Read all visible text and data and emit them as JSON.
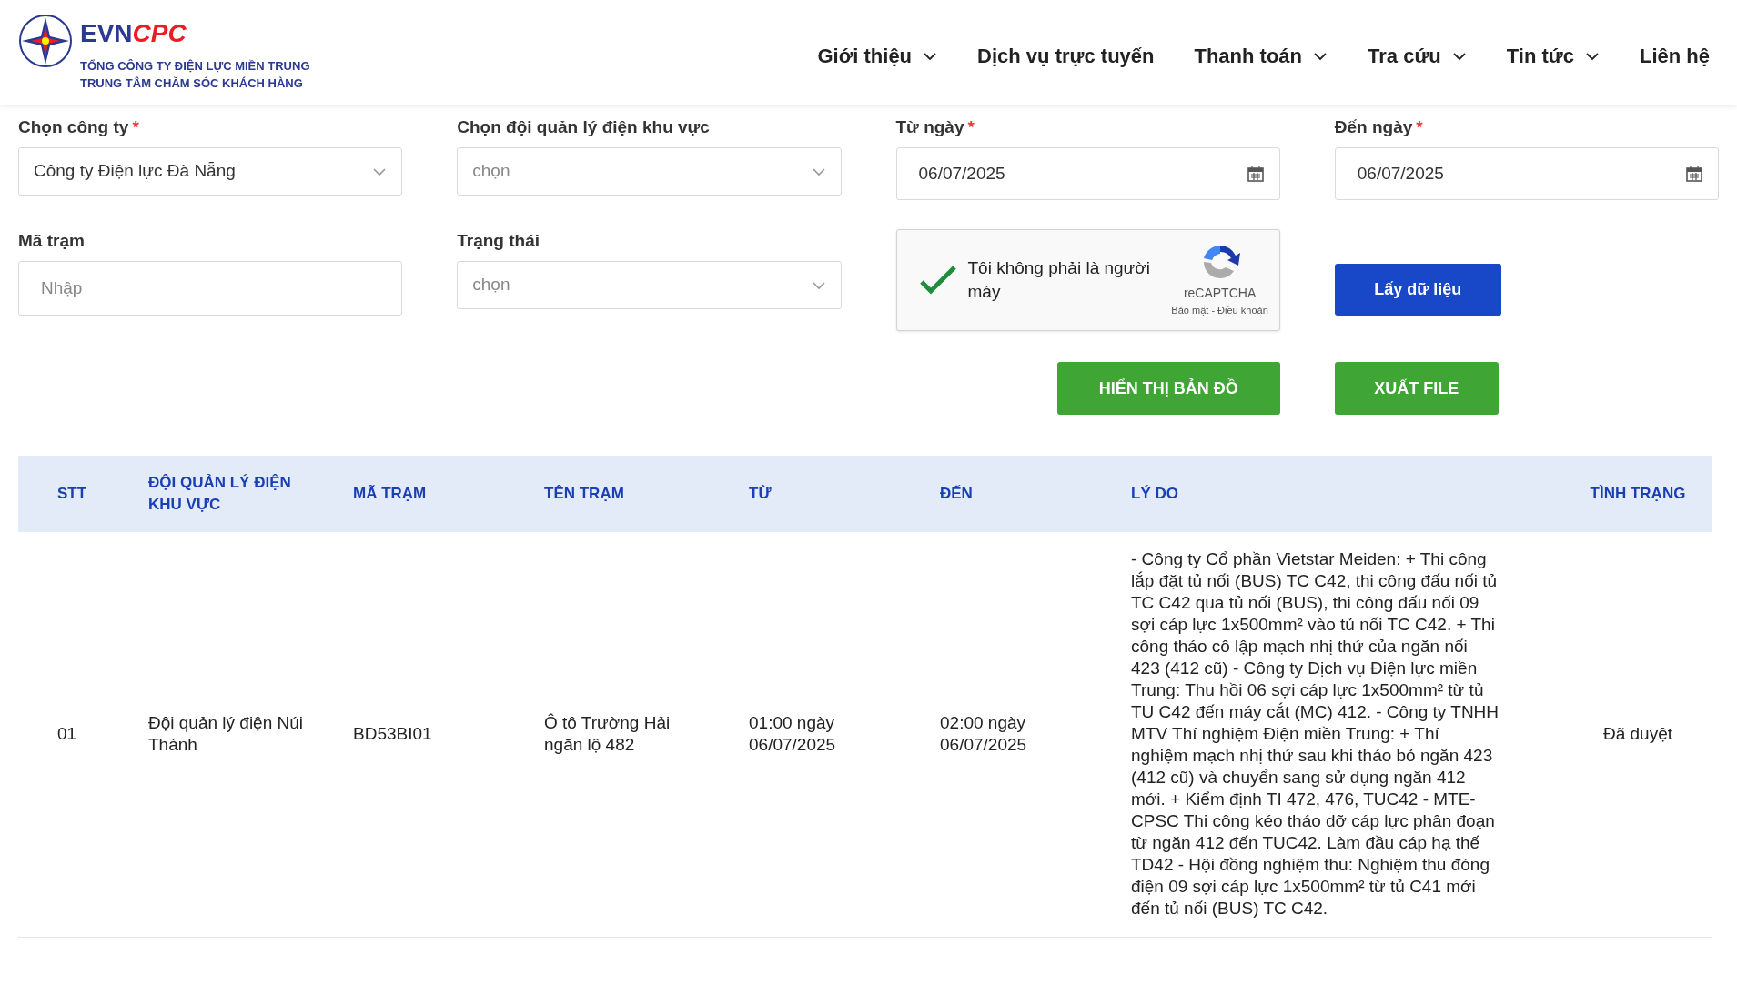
{
  "logo": {
    "brand_left": "EVN",
    "brand_right": "CPC",
    "line_1": "TỔNG CÔNG TY ĐIỆN LỰC MIỀN TRUNG",
    "line_2": "TRUNG TÂM CHĂM SÓC KHÁCH HÀNG"
  },
  "nav": [
    {
      "label": "Giới thiệu",
      "dropdown": true
    },
    {
      "label": "Dịch vụ trực tuyến",
      "dropdown": false
    },
    {
      "label": "Thanh toán",
      "dropdown": true
    },
    {
      "label": "Tra cứu",
      "dropdown": true
    },
    {
      "label": "Tin tức",
      "dropdown": true
    },
    {
      "label": "Liên hệ",
      "dropdown": false
    }
  ],
  "filters_row_1": [
    {
      "kind": "select",
      "label": "Chọn công ty",
      "required": true,
      "value": "Công ty Điện lực Đà Nẵng"
    },
    {
      "kind": "select",
      "label": "Chọn đội quản lý điện khu vực",
      "required": false,
      "placeholder": "chọn"
    },
    {
      "kind": "date",
      "label": "Từ ngày",
      "required": true,
      "value": "06/07/2025"
    },
    {
      "kind": "date",
      "label": "Đến ngày",
      "required": true,
      "value": "06/07/2025"
    }
  ],
  "filters_row_2": [
    {
      "kind": "text",
      "label": "Mã trạm",
      "required": false,
      "placeholder": "Nhập"
    },
    {
      "kind": "select",
      "label": "Trạng thái",
      "required": false,
      "placeholder": "chọn"
    }
  ],
  "recaptcha": {
    "checked": true,
    "label": "Tôi không phải là người máy",
    "brand": "reCAPTCHA",
    "links": "Bảo mật - Điều khoản"
  },
  "required_mark": "*",
  "fetch_button": "Lấy dữ liệu",
  "action_buttons": [
    "HIỂN THỊ BẢN ĐỒ",
    "XUẤT FILE"
  ],
  "table": {
    "columns": [
      "STT",
      "ĐỘI QUẢN LÝ ĐIỆN KHU VỰC",
      "MÃ TRẠM",
      "TÊN TRẠM",
      "TỪ",
      "ĐẾN",
      "LÝ DO",
      "TÌNH TRẠNG"
    ],
    "rows": [
      [
        "01",
        "Đội quản lý điện Núi Thành",
        "BD53BI01",
        "Ô tô Trường Hải ngăn lộ 482",
        "01:00 ngày 06/07/2025",
        "02:00 ngày 06/07/2025",
        "- Công ty Cổ phần Vietstar Meiden: + Thi công lắp đặt tủ nối (BUS) TC C42, thi công đấu nối tủ TC C42 qua tủ nối (BUS), thi công đấu nối 09 sợi cáp lực 1x500mm² vào tủ nối TC C42. + Thi công tháo cô lập mạch nhị thứ của ngăn nối 423 (412 cũ) - Công ty Dịch vụ Điện lực miền Trung: Thu hồi 06 sợi cáp lực 1x500mm² từ tủ TU C42 đến máy cắt (MC) 412. - Công ty TNHH MTV Thí nghiệm Điện miền Trung: + Thí nghiệm mạch nhị thứ sau khi tháo bỏ ngăn 423 (412 cũ) và chuyển sang sử dụng ngăn 412 mới. + Kiểm định TI 472, 476, TUC42 - MTE-CPSC Thi công kéo tháo dỡ cáp lực phân đoạn từ ngăn 412 đến TUC42. Làm đầu cáp hạ thế TD42 - Hội đồng nghiệm thu: Nghiệm thu đóng điện 09 sợi cáp lực 1x500mm² từ tủ C41 mới đến tủ nối (BUS) TC C42.",
        "Đã duyệt"
      ]
    ]
  }
}
